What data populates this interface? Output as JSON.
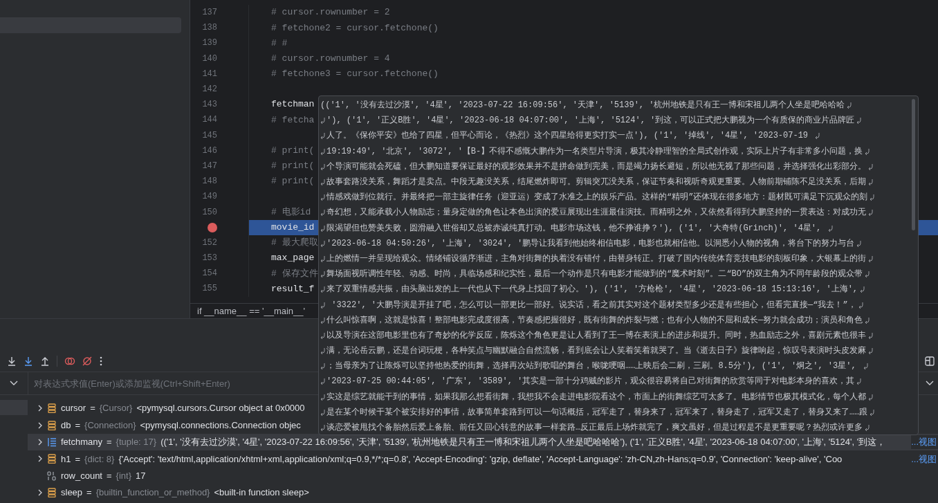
{
  "editor": {
    "lines": [
      {
        "number": "137",
        "code": "# cursor.rownumber = 2",
        "kind": "comment",
        "breakpoint": false,
        "selected": false
      },
      {
        "number": "138",
        "code": "# fetchone2 = cursor.fetchone()",
        "kind": "comment",
        "breakpoint": false,
        "selected": false
      },
      {
        "number": "139",
        "code": "# #",
        "kind": "comment",
        "breakpoint": false,
        "selected": false
      },
      {
        "number": "140",
        "code": "# cursor.rownumber = 4",
        "kind": "comment",
        "breakpoint": false,
        "selected": false
      },
      {
        "number": "141",
        "code": "# fetchone3 = cursor.fetchone()",
        "kind": "comment",
        "breakpoint": false,
        "selected": false
      },
      {
        "number": "142",
        "kind": "blank",
        "breakpoint": false,
        "selected": false
      },
      {
        "number": "143",
        "code": "fetchman",
        "kind": "code",
        "breakpoint": false,
        "selected": false
      },
      {
        "number": "144",
        "code": "# fetcha",
        "kind": "comment",
        "breakpoint": false,
        "selected": false
      },
      {
        "number": "145",
        "kind": "blank",
        "breakpoint": false,
        "selected": false
      },
      {
        "number": "146",
        "code": "# print(",
        "kind": "comment",
        "breakpoint": false,
        "selected": false
      },
      {
        "number": "147",
        "code": "# print(",
        "kind": "comment",
        "breakpoint": false,
        "selected": false
      },
      {
        "number": "148",
        "code": "# print(",
        "kind": "comment",
        "breakpoint": false,
        "selected": false
      },
      {
        "number": "149",
        "kind": "blank",
        "breakpoint": false,
        "selected": false
      },
      {
        "number": "150",
        "code": "# 电影id",
        "kind": "comment",
        "breakpoint": false,
        "selected": false
      },
      {
        "kind": "code",
        "code": "movie_id",
        "breakpoint": true,
        "selected": true
      },
      {
        "number": "152",
        "code": "# 最大爬取",
        "kind": "comment",
        "breakpoint": false,
        "selected": false
      },
      {
        "number": "153",
        "code": "max_page",
        "kind": "code",
        "breakpoint": false,
        "selected": false
      },
      {
        "number": "154",
        "code": "# 保存文件",
        "kind": "comment",
        "breakpoint": false,
        "selected": false
      },
      {
        "number": "155",
        "code": "result_f",
        "kind": "code",
        "breakpoint": false,
        "selected": false
      }
    ],
    "breadcrumb": "if __name__ == '__main__'"
  },
  "tooltip": {
    "lines": [
      {
        "text": "(('1', '没有去过沙漠', '4星', '2023-07-22 16:09:56', '天津', '5139', '杭州地铁是只有王一博和宋祖儿两个人坐是吧哈哈哈",
        "continued": false
      },
      {
        "text": "'), ('1', '正义B胜', '4星', '2023-06-18 04:07:00', '上海', '5124', '到这，可以正式把大鹏视为一个有质保的商业片品牌匠",
        "continued": true
      },
      {
        "text": "人了。《保你平安》也给了四星，但平心而论，《热烈》这个四星给得更实打实一点'), ('1', '掉线', '4星', '2023-07-19 ",
        "continued": true
      },
      {
        "text": "19:19:49', '北京', '3072', '【B-】不得不感慨大鹏作为一名类型片导演，极其冷静理智的全局式创作观，实际上片子有非常多小问题，换",
        "continued": true
      },
      {
        "text": "个导演可能就会死磕，但大鹏知道要保证最好的观影效果并不是拼命做到完美，而是竭力扬长避短，所以他无视了那些问题，并选择强化出彩部分。",
        "continued": true
      },
      {
        "text": "故事套路没关系，舞蹈才是卖点。中段无趣没关系，结尾燃炸即可。剪辑突兀没关系，保证节奏和视听奇观更重要。人物前期铺陈不足没关系，后期",
        "continued": true
      },
      {
        "text": "情感戏做到位就行。并最终把一部主旋律任务（迎亚运）变成了水准之上的娱乐产品。这样的“精明”还体现在很多地方：题材既可满足下沉观众的刻",
        "continued": true
      },
      {
        "text": "奇幻想，又能承载小人物励志；量身定做的角色让本色出演的爱豆展现出生涯最佳演技。而精明之外，又依然看得到大鹏坚持的一贯表达：对成功无",
        "continued": true
      },
      {
        "text": "限渴望但也赞美失败，圆滑融入世俗却又总被赤诚纯真打动。电影市场这钱，他不挣谁挣？'), ('1', '大奇特(Grinch)', '4星', ",
        "continued": true
      },
      {
        "text": "'2023-06-18 04:50:26', '上海', '3024', '鹏导让我看到他始终相信电影，电影也就相信他。以洞悉小人物的视角，将台下的努力与台",
        "continued": true
      },
      {
        "text": "上的燃情一并呈现给观众。情绪铺设循序渐进，主角对街舞的执着没有错付，由替身转正。打破了国内传统体育竞技电影的刻板印象，大银幕上的街",
        "continued": true
      },
      {
        "text": "舞场面视听调性年轻、动感、时尚，具临场感和纪实性，最后一个动作是只有电影才能做到的“魔术时刻”。二“BO”的双主角为不同年龄段的观众带",
        "continued": true
      },
      {
        "text": "来了双重情感共振，由头脑出发的上一代也从下一代身上找回了初心。'), ('1', '方枪枪', '4星', '2023-06-18 15:13:16', '上海',",
        "continued": true
      },
      {
        "text": " '3322', '大鹏导演是开挂了吧，怎么可以一部更比一部好。说实话，看之前其实对这个题材类型多少还是有些担心，但看完直接—“我去！”，",
        "continued": true
      },
      {
        "text": "什么叫惊喜啊，这就是惊喜！整部电影完成度很高，节奏感把握很好，既有街舞的炸裂与燃；也有小人物的不屈和成长—努力就会成功；演员和角色",
        "continued": true
      },
      {
        "text": "以及导演在这部电影里也有了奇妙的化学反应，陈烁这个角色更是让人看到了王一博在表演上的进步和提升。同时，热血励志之外，喜剧元素也很丰",
        "continued": true
      },
      {
        "text": "满，无论岳云鹏，还是台词玩梗，各种笑点与幽默融合自然流畅，看到底会让人笑着笑着就哭了。当《逝去日子》旋律响起，惊叹号表演时头皮发麻",
        "continued": true
      },
      {
        "text": "；当母亲为了让陈烁可以坚持他热爱的街舞，选择再次站到歌唱的舞台，喉咙哽咽……上映后会二刷，三刷。8.5分'), ('1', '炯之', '3星', ",
        "continued": true
      },
      {
        "text": "'2023-07-25 00:44:05', '广东', '3589', '其实是一部十分鸡贼的影片，观众很容易将自己对街舞的欣赏等同于对电影本身的喜欢，其",
        "continued": true
      },
      {
        "text": "实这是综艺就能干到的事情，如果我那么想看街舞，我想我不会走进电影院看这个，市面上的街舞综艺可太多了。电影情节也极其模式化，每个人都",
        "continued": true
      },
      {
        "text": "是在某个时候干某个被安排好的事情，故事简单套路到可以一句话概括，冠军走了，替身来了，冠军来了，替身走了，冠军又走了，替身又来了……跟",
        "continued": true
      },
      {
        "text": "谈恋爱被甩找个备胎然后爱上备胎、前任又回心转意的故事一样套路…反正最后上场炸就完了，爽文虽好，但是过程是不是更重要呢？热烈或许更多",
        "continued": true
      }
    ]
  },
  "debugger": {
    "evaluate": {
      "placeholder": "对表达式求值(Enter)或添加监视(Ctrl+Shift+Enter)"
    },
    "variables": [
      {
        "name": "cursor",
        "separator": "=",
        "type": "{Cursor}",
        "value": "<pymysql.cursors.Cursor object at 0x0000",
        "kind": "object",
        "expandable": true,
        "selected": false
      },
      {
        "name": "db",
        "separator": "=",
        "type": "{Connection}",
        "value": "<pymysql.connections.Connection objec",
        "kind": "object",
        "expandable": true,
        "selected": false
      },
      {
        "name": "fetchmany",
        "separator": "=",
        "type": "{tuple: 17}",
        "value": "(('1', '没有去过沙漠', '4星', '2023-07-22 16:09:56', '天津', '5139', '杭州地铁是只有王一博和宋祖儿两个人坐是吧哈哈哈'), ('1', '正义B胜', '4星', '2023-06-18 04:07:00', '上海', '5124', '到这，",
        "link": "...视图",
        "kind": "list",
        "expandable": true,
        "selected": true
      },
      {
        "name": "h1",
        "separator": "=",
        "type": "{dict: 8}",
        "value": "{'Accept': 'text/html,application/xhtml+xml,application/xml;q=0.9,*/*;q=0.8', 'Accept-Encoding': 'gzip, deflate', 'Accept-Language': 'zh-CN,zh-Hans;q=0.9', 'Connection': 'keep-alive', 'Coo",
        "link": "...视图",
        "kind": "object",
        "expandable": true,
        "selected": false
      },
      {
        "name": "row_count",
        "separator": "=",
        "type": "{int}",
        "value": "17",
        "kind": "int",
        "expandable": false,
        "selected": false
      },
      {
        "name": "sleep",
        "separator": "=",
        "type": "{builtin_function_or_method}",
        "value": "<built-in function sleep>",
        "kind": "object",
        "expandable": true,
        "selected": false
      }
    ]
  }
}
